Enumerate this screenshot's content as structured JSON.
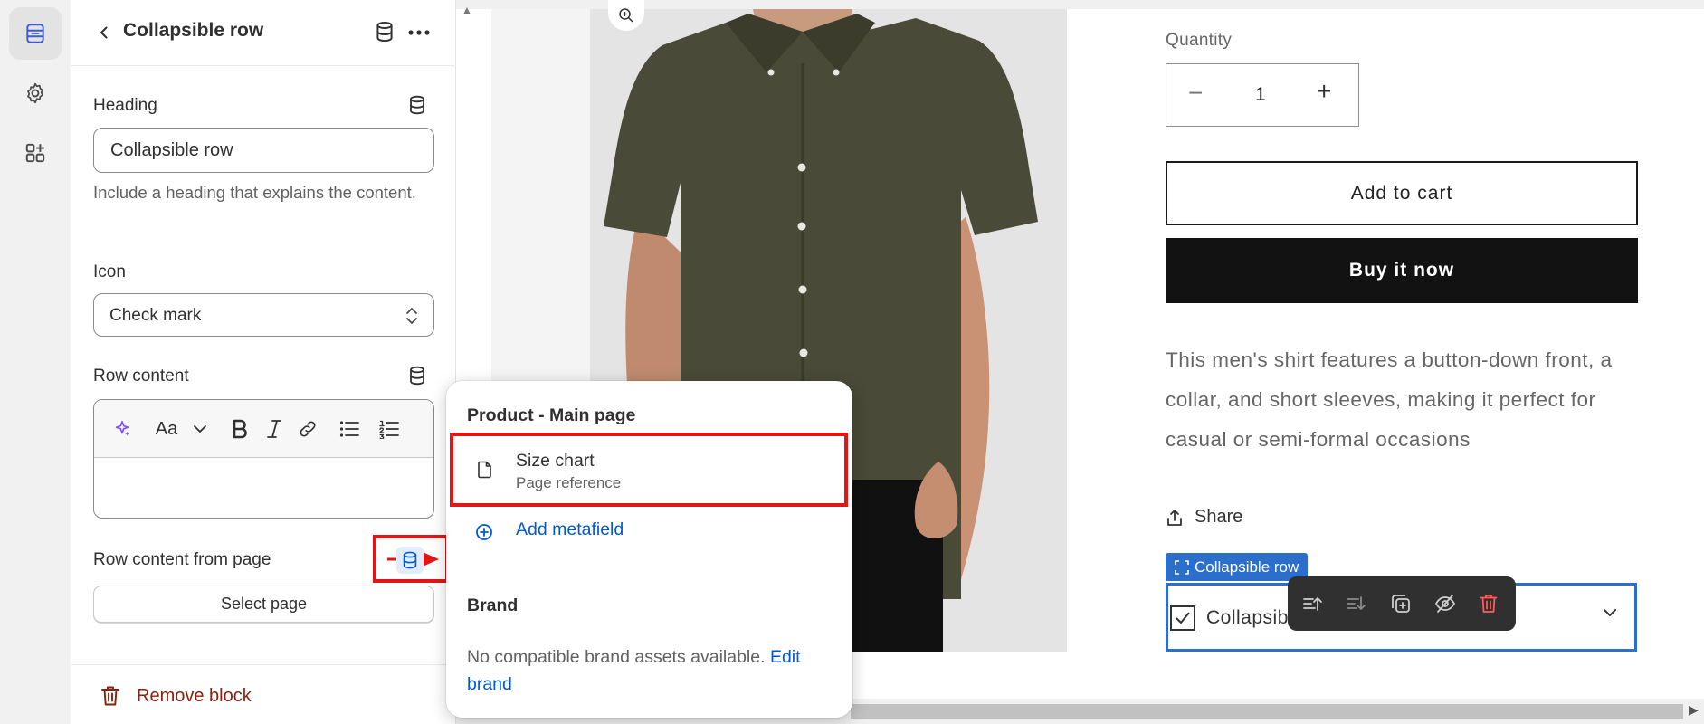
{
  "panel": {
    "title": "Collapsible row",
    "heading": {
      "label": "Heading",
      "value": "Collapsible row",
      "help": "Include a heading that explains the content."
    },
    "icon": {
      "label": "Icon",
      "value": "Check mark"
    },
    "row_content": {
      "label": "Row content",
      "toolbar": [
        "magic-icon",
        "Aa",
        "chevron-down-icon",
        "bold-icon",
        "italic-icon",
        "link-icon",
        "bullet-list-icon",
        "numbered-list-icon"
      ],
      "font_label": "Aa"
    },
    "row_content_from_page": {
      "label": "Row content from page",
      "select_page": "Select page"
    },
    "remove_block": "Remove block"
  },
  "popover": {
    "section_product": "Product - Main page",
    "item_title": "Size chart",
    "item_sub": "Page reference",
    "add_metafield": "Add metafield",
    "section_brand": "Brand",
    "no_brand_text": "No compatible brand assets available.",
    "edit_brand": "Edit brand"
  },
  "product": {
    "quantity_label": "Quantity",
    "quantity_value": "1",
    "quantity_minus": "−",
    "quantity_plus": "+",
    "add_to_cart": "Add to cart",
    "buy_now": "Buy it now",
    "description": "This men's shirt features a button-down front, a collar, and short sleeves, making it perfect for casual or semi-formal occasions",
    "share": "Share",
    "collapsible_tag": "Collapsible row",
    "collapsible_text": "Collapsible row"
  },
  "colors": {
    "accent_blue": "#2c6ecb",
    "link_blue": "#005bd3",
    "highlight_red": "#e11717",
    "critical": "#8e1f0b",
    "buy_now_bg": "#121212",
    "shirt": "#4a4a38"
  }
}
